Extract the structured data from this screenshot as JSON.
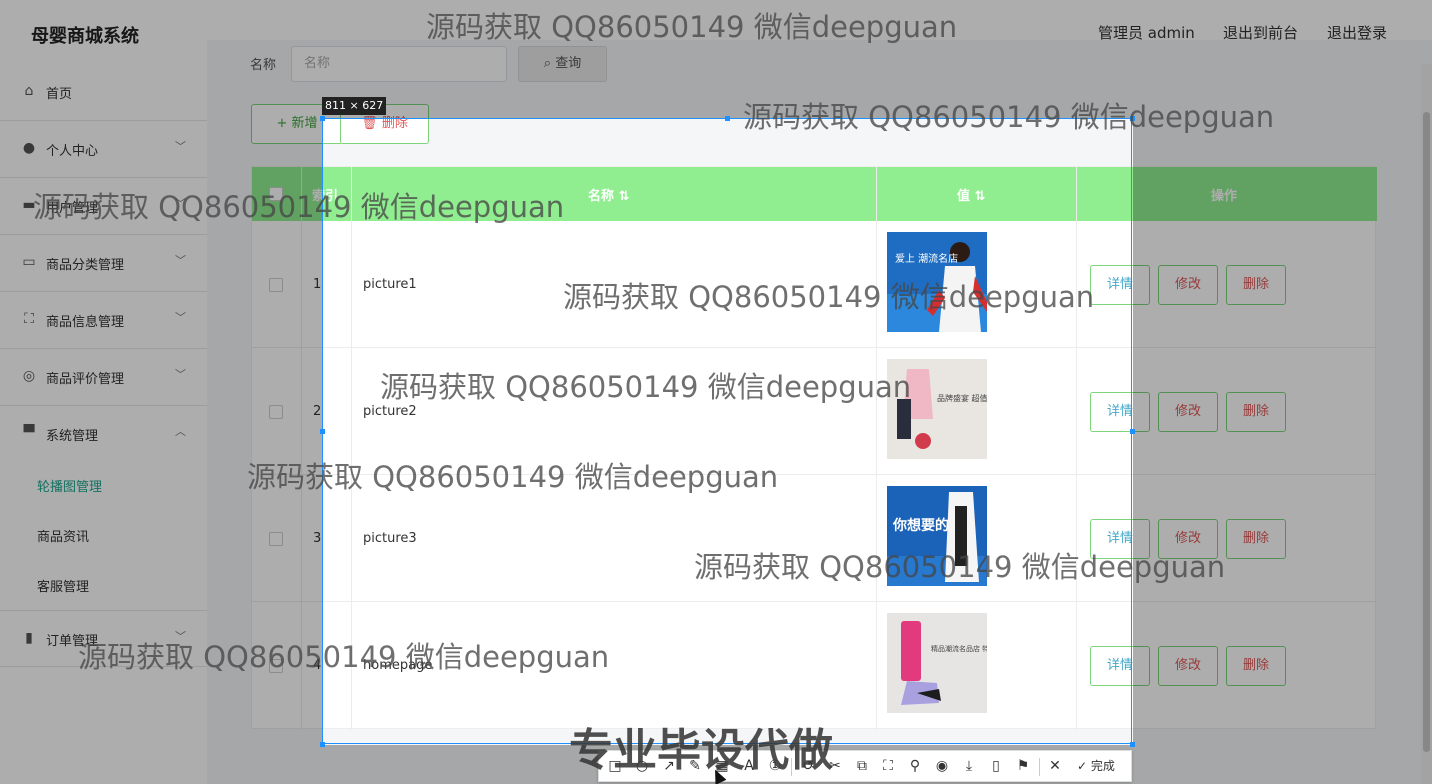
{
  "header": {
    "brand": "母婴商城系统",
    "admin_label": "管理员 admin",
    "to_front": "退出到前台",
    "logout": "退出登录"
  },
  "sidebar": {
    "items": [
      {
        "label": "首页",
        "icon": "home-icon"
      },
      {
        "label": "个人中心",
        "icon": "user-icon",
        "chevron": "down"
      },
      {
        "label": "用户管理",
        "icon": "users-icon",
        "chevron": "down"
      },
      {
        "label": "商品分类管理",
        "icon": "chat-icon",
        "chevron": "down"
      },
      {
        "label": "商品信息管理",
        "icon": "scan-icon",
        "chevron": "down"
      },
      {
        "label": "商品评价管理",
        "icon": "compass-icon",
        "chevron": "down"
      },
      {
        "label": "系统管理",
        "icon": "system-icon",
        "chevron": "up"
      },
      {
        "label": "订单管理",
        "icon": "chart-icon",
        "chevron": "down"
      }
    ],
    "sub_items": [
      {
        "label": "轮播图管理",
        "active": true
      },
      {
        "label": "商品资讯",
        "active": false
      },
      {
        "label": "客服管理",
        "active": false
      }
    ]
  },
  "search": {
    "label": "名称",
    "placeholder": "名称",
    "button": "查询"
  },
  "actions": {
    "add": "新增",
    "delete": "删除"
  },
  "table": {
    "columns": [
      "",
      "索引",
      "名称",
      "值",
      "操作"
    ],
    "rows": [
      {
        "index": "1",
        "name": "picture1",
        "thumb_text": "爱上 潮流名店"
      },
      {
        "index": "2",
        "name": "picture2",
        "thumb_text": "品牌盛宴 超值精品大集合"
      },
      {
        "index": "3",
        "name": "picture3",
        "thumb_text": "你想要的"
      },
      {
        "index": "4",
        "name": "homepage",
        "thumb_text": "精品潮流名品店 特惠专场"
      }
    ],
    "row_buttons": {
      "detail": "详情",
      "edit": "修改",
      "remove": "删除"
    }
  },
  "capture": {
    "size": "811 × 627",
    "done": "完成"
  },
  "watermark": "源码获取 QQ86050149 微信deepguan",
  "promo": "专业毕设代做",
  "colors": {
    "accent": "#1aa88f",
    "table_header": "#90ee90",
    "button_border": "#7dd47d",
    "danger": "#e15757",
    "frame": "#1e90ff"
  }
}
